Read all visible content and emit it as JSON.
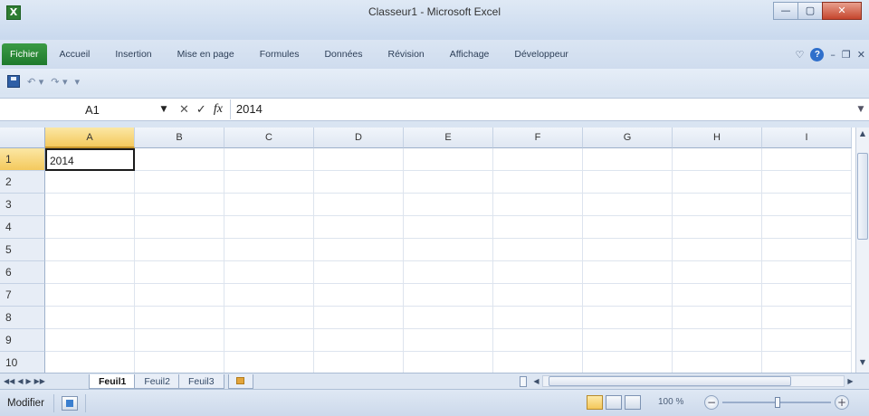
{
  "window": {
    "title": "Classeur1 - Microsoft Excel",
    "app_icon_glyph": "X",
    "minimize_glyph": "—",
    "maximize_glyph": "▢",
    "close_glyph": "✕"
  },
  "ribbon": {
    "tabs": [
      {
        "label": "Fichier"
      },
      {
        "label": "Accueil"
      },
      {
        "label": "Insertion"
      },
      {
        "label": "Mise en page"
      },
      {
        "label": "Formules"
      },
      {
        "label": "Données"
      },
      {
        "label": "Révision"
      },
      {
        "label": "Affichage"
      },
      {
        "label": "Développeur"
      }
    ],
    "right_icons": [
      "collapse-ribbon-icon",
      "help-icon",
      "minimize-workbook-icon",
      "restore-workbook-icon",
      "close-workbook-icon"
    ],
    "help_glyph": "?",
    "caret_glyph": "♡"
  },
  "quick_access": {
    "undo_glyph": "↶ ▾",
    "redo_glyph": "↷ ▾",
    "customize_glyph": "▾"
  },
  "formula_bar": {
    "name_box_value": "A1",
    "name_box_dropdown": "▼",
    "cancel_glyph": "✕",
    "enter_glyph": "✓",
    "fx_label": "fx",
    "formula_value": "2014",
    "expand_glyph": "▼"
  },
  "grid": {
    "columns": [
      "A",
      "B",
      "C",
      "D",
      "E",
      "F",
      "G",
      "H",
      "I"
    ],
    "active_column": "A",
    "rows": [
      "1",
      "2",
      "3",
      "4",
      "5",
      "6",
      "7",
      "8",
      "9",
      "10"
    ],
    "active_row": "1",
    "cells": {
      "A1": "2014"
    },
    "selected_cell": "A1"
  },
  "scrollbars": {
    "up_glyph": "▲",
    "down_glyph": "▼",
    "left_glyph": "◀",
    "right_glyph": "▶"
  },
  "sheets": {
    "nav_glyphs": [
      "◀◀",
      "◀",
      "▶",
      "▶▶"
    ],
    "tabs": [
      {
        "label": "Feuil1",
        "active": true
      },
      {
        "label": "Feuil2",
        "active": false
      },
      {
        "label": "Feuil3",
        "active": false
      }
    ]
  },
  "status_bar": {
    "mode": "Modifier",
    "zoom_label": "100 %",
    "zoom_minus": "−",
    "zoom_plus": "+",
    "zoom_percent": 100
  },
  "colors": {
    "file_tab": "#2e8b3a",
    "active_header": "#f4c95d",
    "selection_border": "#1b1b1b"
  }
}
